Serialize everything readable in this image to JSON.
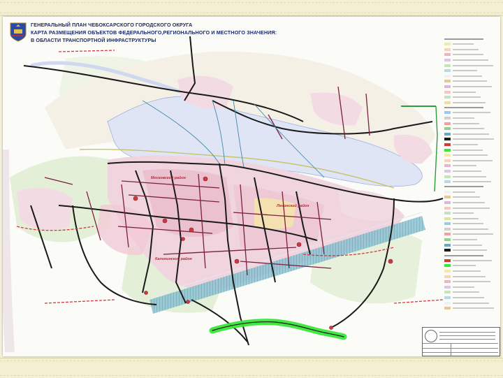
{
  "title": {
    "line1": "ГЕНЕРАЛЬНЫЙ ПЛАН ЧЕБОКСАРСКОГО ГОРОДСКОГО ОКРУГА",
    "line2": "КАРТА РАЗМЕЩЕНИЯ ОБЪЕКТОВ ФЕДЕРАЛЬНОГО,РЕГИОНАЛЬНОГО И МЕСТНОГО ЗНАЧЕНИЯ:",
    "line3": "В ОБЛАСТИ ТРАНСПОРТНОЙ ИНФРАСТРУКТУРЫ"
  },
  "map_labels": {
    "district_1": "Калининский район",
    "district_2": "Ленинский район",
    "district_3": "Московский район"
  },
  "colors": {
    "river": "#dfe5f5",
    "urban": "#f2c8d6",
    "green": "#dfeccf",
    "road_main": "#1a1a1a",
    "road_secondary": "#7a1f3c",
    "road_new": "#d23a3a",
    "rail_corridor": "#6aa7c0",
    "highlight_bypass": "#39e639"
  },
  "legend_swatches": [
    "#f5e9a8",
    "#f7d3b8",
    "#e9b6c6",
    "#d9c7e8",
    "#c8e4b8",
    "#b8d8e8",
    "#f1f1f1",
    "#e7c59a",
    "#d7b8d8",
    "#f7c7c7",
    "#c5e0c5",
    "#e8e0a0",
    "#a0c8e8",
    "#d0d0d0",
    "#f0a0a0",
    "#8fd18f",
    "#6aa7c0",
    "#1a1a1a",
    "#d23a3a",
    "#39e639"
  ]
}
